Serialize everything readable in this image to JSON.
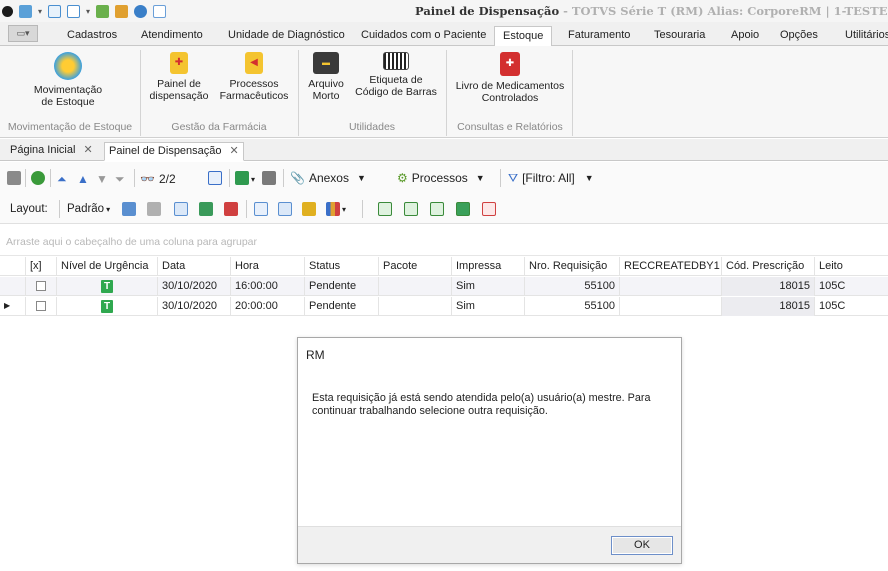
{
  "window": {
    "title_main": "Painel de Dispensação",
    "title_sub": " - TOTVS Série T  (RM)  Alias: CorporeRM  |  1-TESTE"
  },
  "ribbon_tabs": [
    "Cadastros",
    "Atendimento",
    "Unidade de Diagnóstico",
    "Cuidados com o Paciente",
    "Estoque",
    "Faturamento",
    "Tesouraria",
    "Apoio",
    "Opções",
    "Utilitários"
  ],
  "active_tab": "Estoque",
  "ribbon": {
    "mov_estoque": "Movimentação\nde Estoque",
    "painel": "Painel de\ndispensação",
    "processos": "Processos\nFarmacêuticos",
    "arquivo": "Arquivo\nMorto",
    "etiqueta": "Etiqueta de\nCódigo de Barras",
    "livro": "Livro de Medicamentos\nControlados",
    "group_mov": "Movimentação de Estoque",
    "group_farm": "Gestão da Farmácia",
    "group_util": "Utilidades",
    "group_cons": "Consultas e Relatórios"
  },
  "doc_tabs": {
    "home": "Página Inicial",
    "panel": "Painel de Dispensação"
  },
  "toolbar": {
    "counter": "2/2",
    "anexos": "Anexos",
    "processos": "Processos",
    "filtro": "[Filtro: All]",
    "layout_label": "Layout:",
    "layout_value": "Padrão"
  },
  "grid": {
    "group_hint": "Arraste aqui o cabeçalho de uma coluna para agrupar",
    "columns": [
      "[x]",
      "Nível de Urgência",
      "Data",
      "Hora",
      "Status",
      "Pacote",
      "Impressa",
      "Nro. Requisição",
      "RECCREATEDBY1",
      "Cód. Prescrição",
      "Leito"
    ],
    "rows": [
      {
        "urg": "T",
        "data": "30/10/2020",
        "hora": "16:00:00",
        "status": "Pendente",
        "pacote": "",
        "impressa": "Sim",
        "nro": "55100",
        "rec": "",
        "cod": "18015",
        "leito": "105C"
      },
      {
        "urg": "T",
        "data": "30/10/2020",
        "hora": "20:00:00",
        "status": "Pendente",
        "pacote": "",
        "impressa": "Sim",
        "nro": "55100",
        "rec": "",
        "cod": "18015",
        "leito": "105C"
      }
    ]
  },
  "dialog": {
    "title": "RM",
    "message": "Esta requisição já está sendo atendida pelo(a) usuário(a) mestre. Para continuar trabalhando selecione outra requisição.",
    "ok": "OK"
  },
  "colors": {
    "urgency_green": "#2fa84f",
    "accent_red": "#d32f2f",
    "accent_yellow": "#e0b020"
  }
}
